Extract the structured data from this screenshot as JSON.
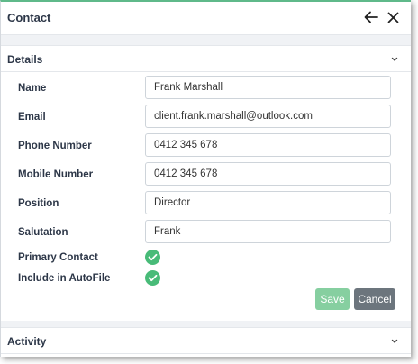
{
  "header": {
    "title": "Contact",
    "back_icon": "arrow-left-icon",
    "close_icon": "close-icon"
  },
  "details": {
    "title": "Details",
    "chevron_icon": "chevron-down-icon",
    "fields": {
      "name": {
        "label": "Name",
        "value": "Frank Marshall"
      },
      "email": {
        "label": "Email",
        "value": "client.frank.marshall@outlook.com"
      },
      "phone": {
        "label": "Phone Number",
        "value": "0412 345 678"
      },
      "mobile": {
        "label": "Mobile Number",
        "value": "0412 345 678"
      },
      "position": {
        "label": "Position",
        "value": "Director"
      },
      "salutation": {
        "label": "Salutation",
        "value": "Frank"
      }
    },
    "toggles": {
      "primary": {
        "label": "Primary Contact",
        "checked": true
      },
      "autofile": {
        "label": "Include in AutoFile",
        "checked": true
      }
    },
    "save_label": "Save",
    "cancel_label": "Cancel"
  },
  "activity": {
    "title": "Activity",
    "chevron_icon": "chevron-down-icon"
  },
  "colors": {
    "accent_green": "#48bb78",
    "save_button": "#86cfa0",
    "cancel_button": "#6c757d",
    "top_border": "#5fb98a"
  }
}
